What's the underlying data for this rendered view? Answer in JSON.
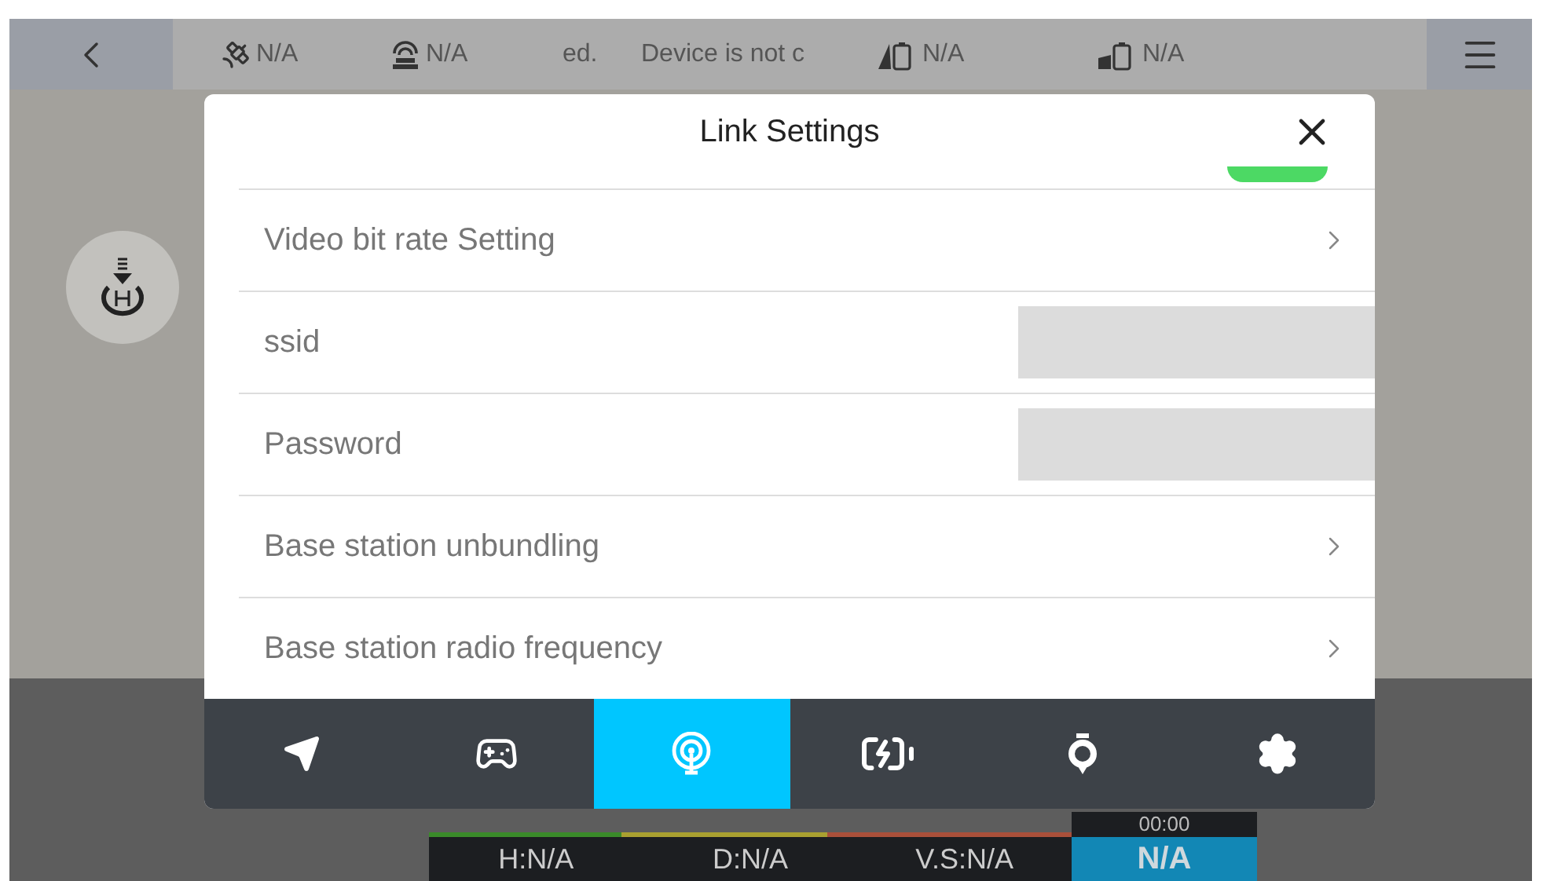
{
  "status_bar": {
    "items": [
      {
        "kind": "satellite",
        "text": "N/A"
      },
      {
        "kind": "remote",
        "text": "N/A"
      },
      {
        "kind": "marquee",
        "text": "ed."
      },
      {
        "kind": "marquee",
        "text": "Device is not c"
      },
      {
        "kind": "aircraft_battery",
        "text": "N/A"
      },
      {
        "kind": "remote_battery",
        "text": "N/A"
      }
    ]
  },
  "dialog": {
    "title": "Link Settings",
    "rows": [
      {
        "kind": "toggle",
        "on": true
      },
      {
        "kind": "link",
        "label": "Video bit rate Setting"
      },
      {
        "kind": "field",
        "label": "ssid"
      },
      {
        "kind": "field",
        "label": "Password"
      },
      {
        "kind": "link",
        "label": "Base station unbundling"
      },
      {
        "kind": "link",
        "label": "Base station radio frequency"
      }
    ],
    "tabs": [
      {
        "kind": "flight",
        "selected": false
      },
      {
        "kind": "controller",
        "selected": false
      },
      {
        "kind": "link",
        "selected": true
      },
      {
        "kind": "battery",
        "selected": false
      },
      {
        "kind": "gimbal",
        "selected": false
      },
      {
        "kind": "general",
        "selected": false
      }
    ]
  },
  "telemetry": {
    "time": "00:00",
    "height": "H:N/A",
    "distance": "D:N/A",
    "vspeed": "V.S:N/A",
    "hspeed": "N/A"
  }
}
